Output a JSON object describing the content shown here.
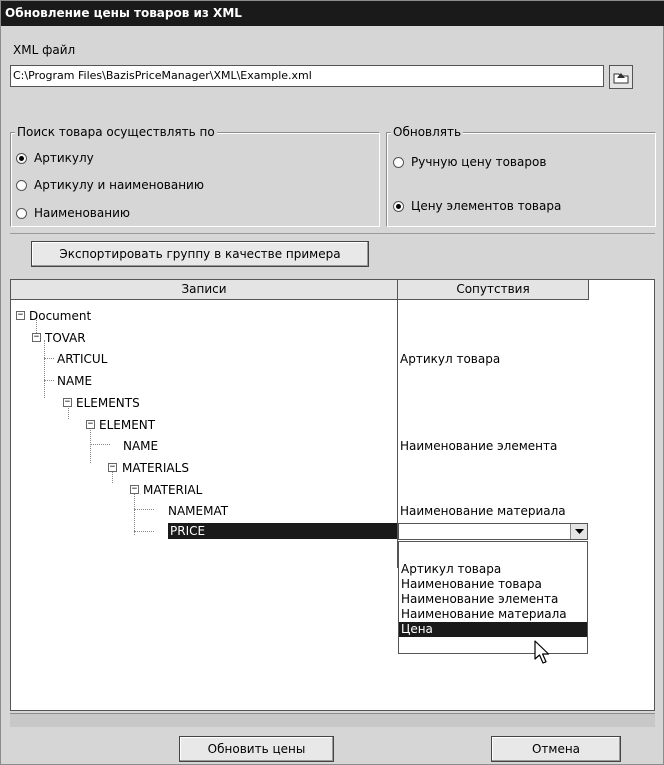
{
  "window": {
    "title": "Обновление цены товаров из XML"
  },
  "file": {
    "label": "XML файл",
    "path": "C:\\Program Files\\BazisPriceManager\\XML\\Example.xml",
    "browse_icon": "open-folder-icon"
  },
  "search_group": {
    "title": "Поиск товара осуществлять по",
    "options": [
      {
        "label": "Артикулу",
        "checked": true
      },
      {
        "label": "Артикулу и наименованию",
        "checked": false
      },
      {
        "label": "Наименованию",
        "checked": false
      }
    ]
  },
  "update_group": {
    "title": "Обновлять",
    "options": [
      {
        "label": "Ручную цену товаров",
        "checked": false
      },
      {
        "label": "Цену элементов товара",
        "checked": true
      }
    ]
  },
  "export_button": "Экспортировать группу в качестве примера",
  "table": {
    "columns": [
      "Записи",
      "Сопутствия"
    ],
    "nodes": [
      {
        "name": "Document",
        "mapping": ""
      },
      {
        "name": "TOVAR",
        "mapping": ""
      },
      {
        "name": "ARTICUL",
        "mapping": "Артикул товара"
      },
      {
        "name": "NAME",
        "mapping": ""
      },
      {
        "name": "ELEMENTS",
        "mapping": ""
      },
      {
        "name": "ELEMENT",
        "mapping": ""
      },
      {
        "name": "NAME",
        "mapping": "Наименование элемента"
      },
      {
        "name": "MATERIALS",
        "mapping": ""
      },
      {
        "name": "MATERIAL",
        "mapping": ""
      },
      {
        "name": "NAMEMAT",
        "mapping": "Наименование материала"
      },
      {
        "name": "PRICE",
        "mapping": ""
      }
    ],
    "expand_glyph": "−",
    "dropdown_options": [
      {
        "label": "Артикул товара",
        "selected": false
      },
      {
        "label": "Наименование товара",
        "selected": false
      },
      {
        "label": "Наименование элемента",
        "selected": false
      },
      {
        "label": "Наименование материала",
        "selected": false
      },
      {
        "label": "Цена",
        "selected": true
      }
    ]
  },
  "buttons": {
    "update": "Обновить цены",
    "cancel": "Отмена"
  }
}
